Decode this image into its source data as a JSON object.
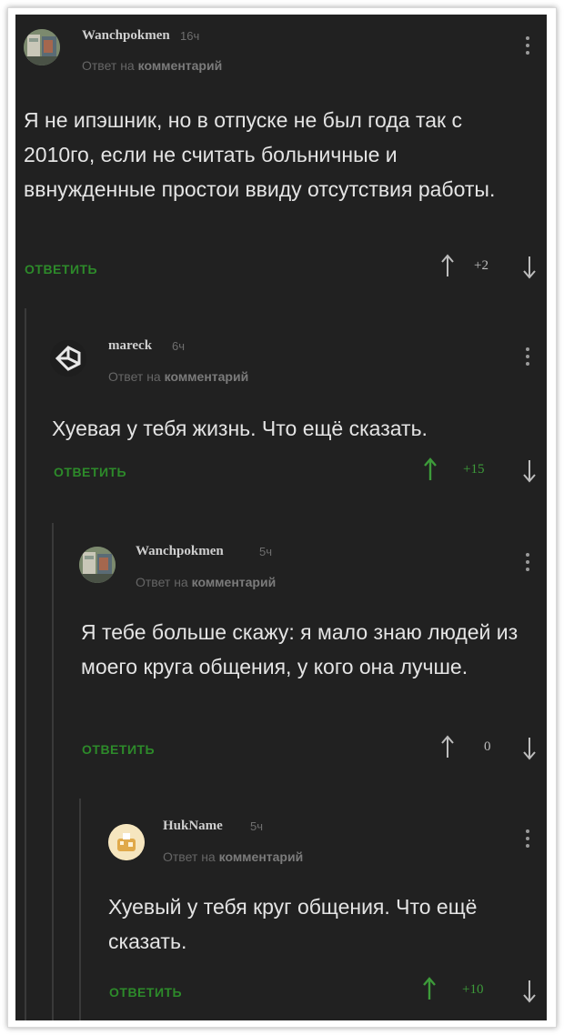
{
  "comments": [
    {
      "username": "Wanchpokmen",
      "time": "16ч",
      "reply_prefix": "Ответ на",
      "reply_target": "комментарий",
      "text": "Я не ипэшник, но в отпуске не был года так с 2010го, если не считать больничные и ввнужденные простои ввиду отсутствия работы.",
      "reply_label": "ОТВЕТИТЬ",
      "score": "+2"
    },
    {
      "username": "mareck",
      "time": "6ч",
      "reply_prefix": "Ответ на",
      "reply_target": "комментарий",
      "text": "Хуевая у тебя жизнь. Что ещё сказать.",
      "reply_label": "ОТВЕТИТЬ",
      "score": "+15"
    },
    {
      "username": "Wanchpokmen",
      "time": "5ч",
      "reply_prefix": "Ответ на",
      "reply_target": "комментарий",
      "text": "Я тебе больше скажу: я мало знаю людей из моего круга общения, у кого она лучше.",
      "reply_label": "ОТВЕТИТЬ",
      "score": "0"
    },
    {
      "username": "HukName",
      "time": "5ч",
      "reply_prefix": "Ответ на",
      "reply_target": "комментарий",
      "text": "Хуевый у тебя круг общения. Что ещё сказать.",
      "reply_label": "ОТВЕТИТЬ",
      "score": "+10"
    }
  ],
  "colors": {
    "background": "#212121",
    "reply_green": "#2d8a2a",
    "upvote_green": "#3d9b3a",
    "text": "#e4e4e4"
  },
  "icons": {
    "upvote": "arrow-up-icon",
    "downvote": "arrow-down-icon",
    "menu": "kebab-menu-icon"
  }
}
